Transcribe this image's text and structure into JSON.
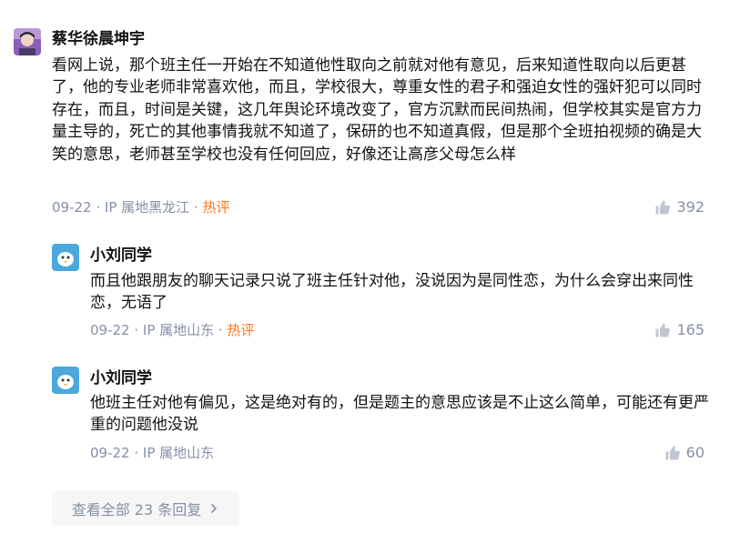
{
  "comments": [
    {
      "author": "蔡华徐晨坤宇",
      "text": "看网上说，那个班主任一开始在不知道他性取向之前就对他有意见，后来知道性取向以后更甚了，他的专业老师非常喜欢他，而且，学校很大，尊重女性的君子和强迫女性的强奸犯可以同时存在，而且，时间是关键，这几年舆论环境改变了，官方沉默而民间热闹，但学校其实是官方力量主导的，死亡的其他事情我就不知道了，保研的也不知道真假，但是那个全班拍视频的确是大笑的意思，老师甚至学校也没有任何回应，好像还让高彦父母怎么样",
      "date": "09-22",
      "sep1": " · ",
      "location": "IP 属地黑龙江",
      "sep2": " · ",
      "badge": "热评",
      "likes": "392"
    },
    {
      "author": "小刘同学",
      "text": "而且他跟朋友的聊天记录只说了班主任针对他，没说因为是同性恋，为什么会穿出来同性恋，无语了",
      "date": "09-22",
      "sep1": " · ",
      "location": "IP 属地山东",
      "sep2": " · ",
      "badge": "热评",
      "likes": "165"
    },
    {
      "author": "小刘同学",
      "text": "他班主任对他有偏见，这是绝对有的，但是题主的意思应该是不止这么简单，可能还有更严重的问题他没说",
      "date": "09-22",
      "sep1": " · ",
      "location": "IP 属地山东",
      "likes": "60"
    }
  ],
  "view_all_replies": "查看全部 23 条回复",
  "colors": {
    "meta": "#8590a6",
    "hot": "#ff761a",
    "button_bg": "#f6f6f6"
  },
  "icons": {
    "like": "thumbs-up-icon",
    "more": "chevron-right-icon"
  }
}
